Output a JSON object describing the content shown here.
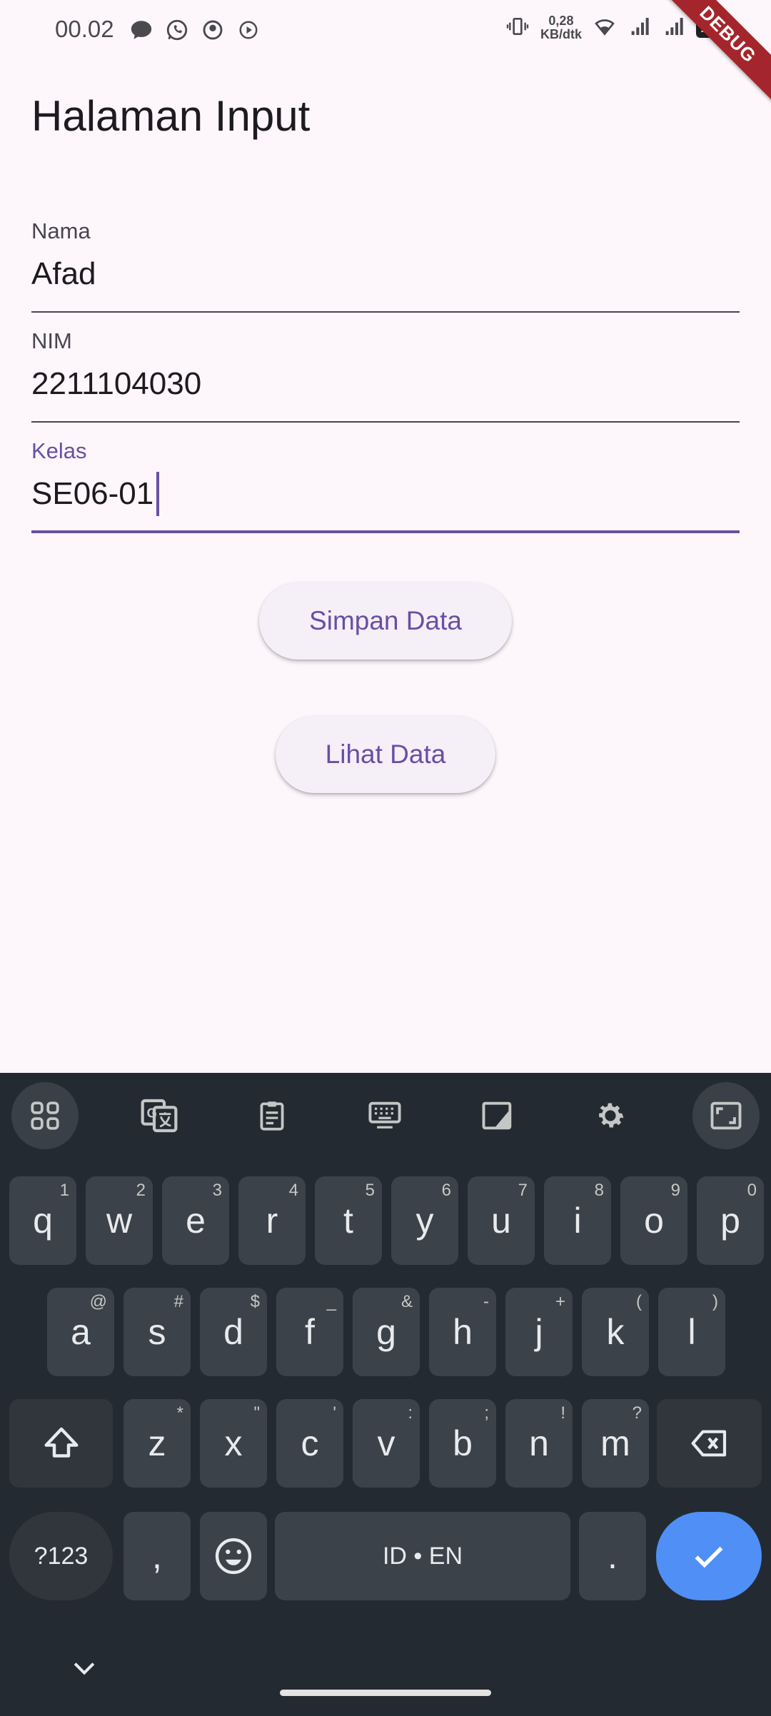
{
  "status_bar": {
    "time": "00.02",
    "net_speed_value": "0,28",
    "net_speed_unit": "KB/dtk",
    "battery": "100",
    "debug_banner": "DEBUG"
  },
  "page": {
    "title": "Halaman Input"
  },
  "form": {
    "nama": {
      "label": "Nama",
      "value": "Afad"
    },
    "nim": {
      "label": "NIM",
      "value": "2211104030"
    },
    "kelas": {
      "label": "Kelas",
      "value": "SE06-01"
    }
  },
  "buttons": {
    "simpan": "Simpan Data",
    "lihat": "Lihat Data"
  },
  "keyboard": {
    "row1": [
      {
        "k": "q",
        "s": "1"
      },
      {
        "k": "w",
        "s": "2"
      },
      {
        "k": "e",
        "s": "3"
      },
      {
        "k": "r",
        "s": "4"
      },
      {
        "k": "t",
        "s": "5"
      },
      {
        "k": "y",
        "s": "6"
      },
      {
        "k": "u",
        "s": "7"
      },
      {
        "k": "i",
        "s": "8"
      },
      {
        "k": "o",
        "s": "9"
      },
      {
        "k": "p",
        "s": "0"
      }
    ],
    "row2": [
      {
        "k": "a",
        "s": "@"
      },
      {
        "k": "s",
        "s": "#"
      },
      {
        "k": "d",
        "s": "$"
      },
      {
        "k": "f",
        "s": "_"
      },
      {
        "k": "g",
        "s": "&"
      },
      {
        "k": "h",
        "s": "-"
      },
      {
        "k": "j",
        "s": "+"
      },
      {
        "k": "k",
        "s": "("
      },
      {
        "k": "l",
        "s": ")"
      }
    ],
    "row3": [
      {
        "k": "z",
        "s": "*"
      },
      {
        "k": "x",
        "s": "\""
      },
      {
        "k": "c",
        "s": "'"
      },
      {
        "k": "v",
        "s": ":"
      },
      {
        "k": "b",
        "s": ";"
      },
      {
        "k": "n",
        "s": "!"
      },
      {
        "k": "m",
        "s": "?"
      }
    ],
    "symbols_key": "?123",
    "comma_key": ",",
    "space_key": "ID • EN",
    "period_key": "."
  }
}
